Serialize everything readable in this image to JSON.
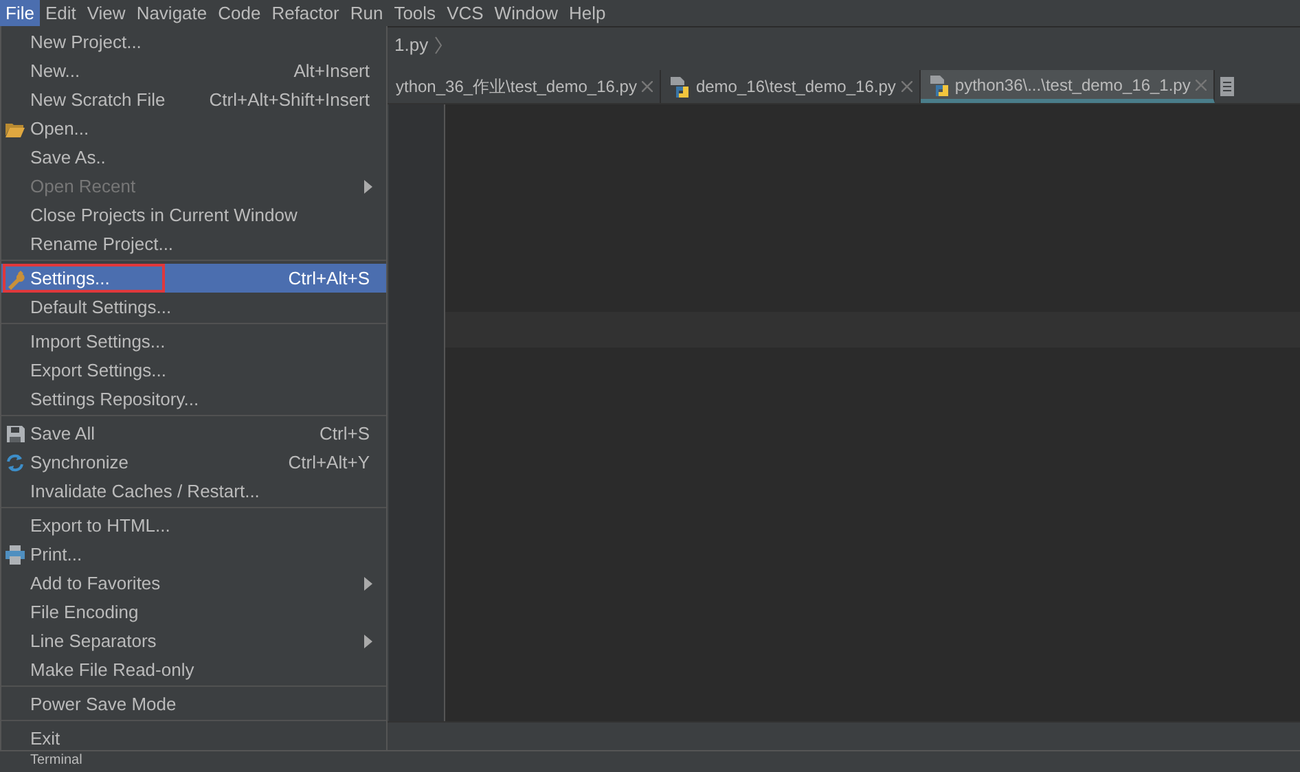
{
  "menubar": [
    {
      "label": "File",
      "selected": true
    },
    {
      "label": "Edit",
      "selected": false
    },
    {
      "label": "View",
      "selected": false
    },
    {
      "label": "Navigate",
      "selected": false
    },
    {
      "label": "Code",
      "selected": false
    },
    {
      "label": "Refactor",
      "selected": false
    },
    {
      "label": "Run",
      "selected": false
    },
    {
      "label": "Tools",
      "selected": false
    },
    {
      "label": "VCS",
      "selected": false
    },
    {
      "label": "Window",
      "selected": false
    },
    {
      "label": "Help",
      "selected": false
    }
  ],
  "breadcrumb": "1.py",
  "tabs": [
    {
      "label": "ython_36_作业\\test_demo_16.py",
      "selected": false
    },
    {
      "label": "demo_16\\test_demo_16.py",
      "selected": false
    },
    {
      "label": "python36\\...\\test_demo_16_1.py",
      "selected": true
    }
  ],
  "file_menu": [
    {
      "kind": "item",
      "label": "New Project..."
    },
    {
      "kind": "item",
      "label": "New...",
      "shortcut": "Alt+Insert"
    },
    {
      "kind": "item",
      "label": "New Scratch File",
      "shortcut": "Ctrl+Alt+Shift+Insert"
    },
    {
      "kind": "item",
      "label": "Open..."
    },
    {
      "kind": "item",
      "label": "Save As.."
    },
    {
      "kind": "item",
      "label": "Open Recent",
      "disabled": true,
      "submenu": true
    },
    {
      "kind": "item",
      "label": "Close Projects in Current Window"
    },
    {
      "kind": "item",
      "label": "Rename Project..."
    },
    {
      "kind": "separator"
    },
    {
      "kind": "item",
      "label": "Settings...",
      "shortcut": "Ctrl+Alt+S",
      "selected": true,
      "annotated": true
    },
    {
      "kind": "item",
      "label": "Default Settings..."
    },
    {
      "kind": "separator"
    },
    {
      "kind": "item",
      "label": "Import Settings..."
    },
    {
      "kind": "item",
      "label": "Export Settings..."
    },
    {
      "kind": "item",
      "label": "Settings Repository..."
    },
    {
      "kind": "separator"
    },
    {
      "kind": "item",
      "label": "Save All",
      "shortcut": "Ctrl+S"
    },
    {
      "kind": "item",
      "label": "Synchronize",
      "shortcut": "Ctrl+Alt+Y"
    },
    {
      "kind": "item",
      "label": "Invalidate Caches / Restart..."
    },
    {
      "kind": "separator"
    },
    {
      "kind": "item",
      "label": "Export to HTML..."
    },
    {
      "kind": "item",
      "label": "Print..."
    },
    {
      "kind": "item",
      "label": "Add to Favorites",
      "submenu": true
    },
    {
      "kind": "item",
      "label": "File Encoding"
    },
    {
      "kind": "item",
      "label": "Line Separators",
      "submenu": true
    },
    {
      "kind": "item",
      "label": "Make File Read-only"
    },
    {
      "kind": "separator"
    },
    {
      "kind": "item",
      "label": "Power Save Mode"
    },
    {
      "kind": "separator"
    },
    {
      "kind": "item",
      "label": "Exit"
    }
  ],
  "bottom_panel": {
    "tab": "Terminal"
  }
}
